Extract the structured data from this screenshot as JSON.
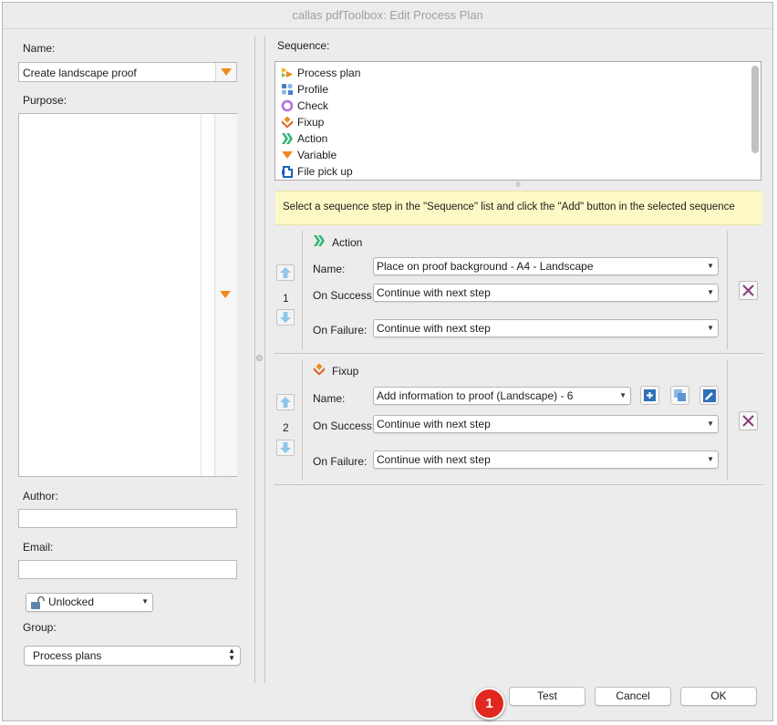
{
  "window": {
    "title": "callas pdfToolbox: Edit Process Plan"
  },
  "left": {
    "name_label": "Name:",
    "name_value": "Create landscape proof",
    "purpose_label": "Purpose:",
    "purpose_value": "",
    "author_label": "Author:",
    "author_value": "",
    "email_label": "Email:",
    "email_value": "",
    "lock_value": "Unlocked",
    "group_label": "Group:",
    "group_value": "Process plans"
  },
  "sequence": {
    "label": "Sequence:",
    "items": [
      {
        "label": "Process plan",
        "icon": "process-plan-icon"
      },
      {
        "label": "Profile",
        "icon": "profile-icon"
      },
      {
        "label": "Check",
        "icon": "check-icon"
      },
      {
        "label": "Fixup",
        "icon": "fixup-icon"
      },
      {
        "label": "Action",
        "icon": "action-icon"
      },
      {
        "label": "Variable",
        "icon": "variable-icon"
      },
      {
        "label": "File pick up",
        "icon": "file-pick-up-icon"
      }
    ],
    "hint": "Select a sequence step in the \"Sequence\" list and click the \"Add\" button in the selected sequence"
  },
  "steps": [
    {
      "number": "1",
      "type": "Action",
      "name_label": "Name:",
      "name_value": "Place on proof background - A4 - Landscape",
      "success_label": "On Success:",
      "success_value": "Continue with next step",
      "failure_label": "On Failure:",
      "failure_value": "Continue with next step"
    },
    {
      "number": "2",
      "type": "Fixup",
      "name_label": "Name:",
      "name_value": "Add information to proof (Landscape) - 6",
      "success_label": "On Success:",
      "success_value": "Continue with next step",
      "failure_label": "On Failure:",
      "failure_value": "Continue with next step"
    }
  ],
  "buttons": {
    "badge": "1",
    "test": "Test",
    "cancel": "Cancel",
    "ok": "OK"
  },
  "colors": {
    "accent_orange": "#f08a1e",
    "action_green": "#2bb673",
    "hint_yellow": "#fdf9c6",
    "badge_red": "#e0281e",
    "delete_purple": "#8a3a7a"
  }
}
